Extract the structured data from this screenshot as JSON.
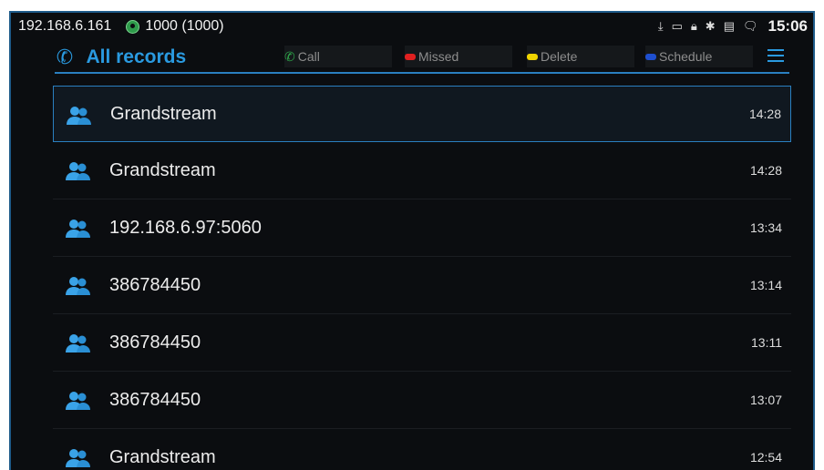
{
  "status": {
    "ip": "192.168.6.161",
    "account": "1000 (1000)",
    "clock": "15:06",
    "icons": [
      "download-icon",
      "screen-icon",
      "lock-icon",
      "bluetooth-icon",
      "sim-icon",
      "message-icon"
    ]
  },
  "toolbar": {
    "title": "All records",
    "call_label": "Call",
    "missed_label": "Missed",
    "delete_label": "Delete",
    "schedule_label": "Schedule"
  },
  "colors": {
    "accent": "#2a9ae0",
    "call": "#2ea84a",
    "missed": "#e02020",
    "delete": "#f0d400",
    "schedule": "#1e4fd0"
  },
  "records": [
    {
      "name": "Grandstream",
      "time": "14:28"
    },
    {
      "name": "Grandstream",
      "time": "14:28"
    },
    {
      "name": "192.168.6.97:5060",
      "time": "13:34"
    },
    {
      "name": "386784450",
      "time": "13:14"
    },
    {
      "name": "386784450",
      "time": "13:11"
    },
    {
      "name": "386784450",
      "time": "13:07"
    },
    {
      "name": "Grandstream",
      "time": "12:54"
    }
  ]
}
